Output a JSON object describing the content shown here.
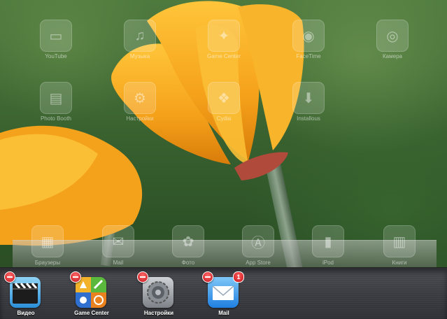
{
  "home_screen": {
    "row1": [
      {
        "label": "YouTube",
        "icon": "youtube-icon"
      },
      {
        "label": "Музыка",
        "icon": "music-icon"
      },
      {
        "label": "Game Center",
        "icon": "game-center-icon"
      },
      {
        "label": "FaceTime",
        "icon": "facetime-icon"
      },
      {
        "label": "Камера",
        "icon": "camera-icon"
      }
    ],
    "row2": [
      {
        "label": "Photo Booth",
        "icon": "photo-booth-icon"
      },
      {
        "label": "Настройки",
        "icon": "settings-icon"
      },
      {
        "label": "Cydia",
        "icon": "cydia-icon"
      },
      {
        "label": "Installous",
        "icon": "installous-icon"
      }
    ]
  },
  "dock": {
    "items": [
      {
        "label": "Браузеры",
        "icon": "browsers-folder-icon"
      },
      {
        "label": "Mail",
        "icon": "mail-icon"
      },
      {
        "label": "Фото",
        "icon": "photos-icon"
      },
      {
        "label": "App Store",
        "icon": "app-store-icon"
      },
      {
        "label": "iPod",
        "icon": "ipod-icon"
      },
      {
        "label": "Книги",
        "icon": "books-folder-icon"
      }
    ]
  },
  "tray": {
    "apps": [
      {
        "label": "Видео",
        "icon": "videos-icon"
      },
      {
        "label": "Game Center",
        "icon": "game-center-icon"
      },
      {
        "label": "Настройки",
        "icon": "settings-icon"
      },
      {
        "label": "Mail",
        "icon": "mail-icon",
        "badge": "1"
      }
    ]
  }
}
